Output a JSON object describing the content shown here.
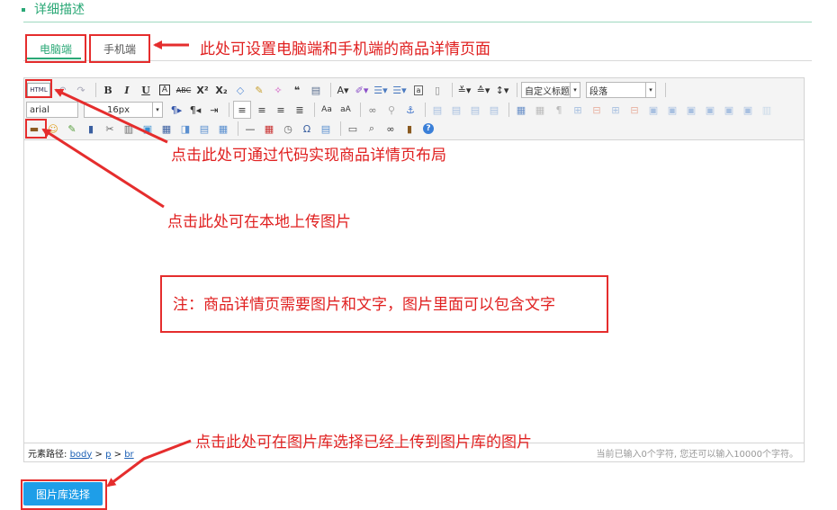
{
  "section": {
    "title": "详细描述"
  },
  "tabs": {
    "pc": "电脑端",
    "mobile": "手机端"
  },
  "notes": {
    "tabs": "此处可设置电脑端和手机端的商品详情页面",
    "html": "点击此处可通过代码实现商品详情页布局",
    "upload": "点击此处可在本地上传图片",
    "content": "注：商品详情页需要图片和文字，图片里面可以包含文字",
    "gallery": "点击此处可在图片库选择已经上传到图片库的图片"
  },
  "toolbar": {
    "html_label": "HTML",
    "font_family": "arial",
    "font_size": "16px",
    "custom_heading": "自定义标题",
    "paragraph": "段落"
  },
  "statusbar": {
    "path_label": "元素路径:",
    "path": [
      "body",
      "p",
      "br"
    ],
    "path_sep": ">",
    "count": "当前已输入0个字符, 您还可以输入10000个字符。"
  },
  "gallery_button": "图片库选择",
  "colors": {
    "accent": "#2aa876",
    "annotation": "#e02020",
    "button": "#1e9ee8"
  }
}
